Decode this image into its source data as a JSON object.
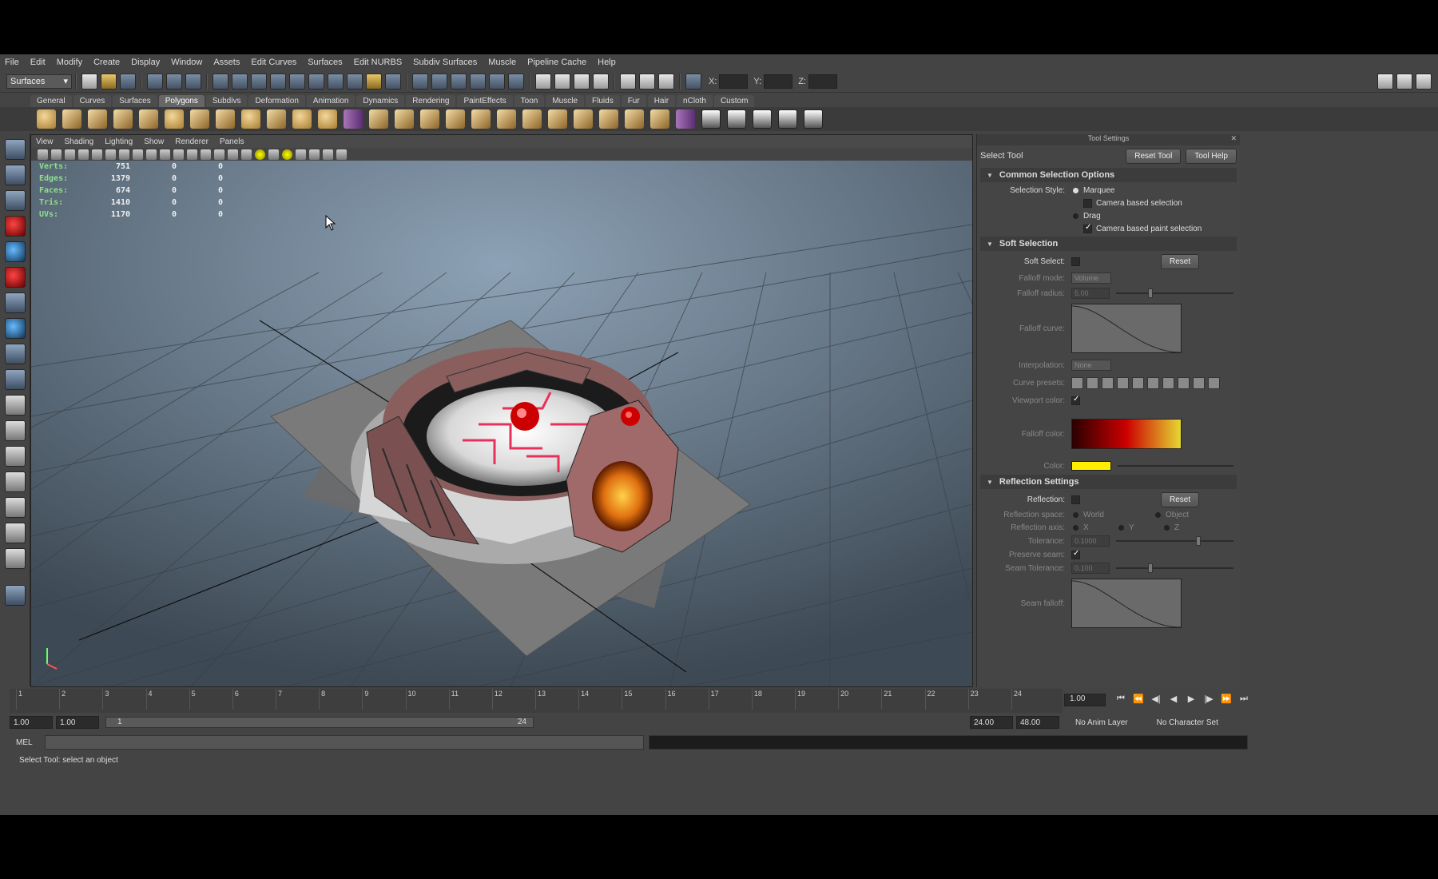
{
  "menu": [
    "File",
    "Edit",
    "Modify",
    "Create",
    "Display",
    "Window",
    "Assets",
    "Edit Curves",
    "Surfaces",
    "Edit NURBS",
    "Subdiv Surfaces",
    "Muscle",
    "Pipeline Cache",
    "Help"
  ],
  "statusline": {
    "menu_set": "Surfaces",
    "x_label": "X:",
    "y_label": "Y:",
    "z_label": "Z:"
  },
  "shelf_tabs": [
    "General",
    "Curves",
    "Surfaces",
    "Polygons",
    "Subdivs",
    "Deformation",
    "Animation",
    "Dynamics",
    "Rendering",
    "PaintEffects",
    "Toon",
    "Muscle",
    "Fluids",
    "Fur",
    "Hair",
    "nCloth",
    "Custom"
  ],
  "shelf_active": "Polygons",
  "viewport_menu": [
    "View",
    "Shading",
    "Lighting",
    "Show",
    "Renderer",
    "Panels"
  ],
  "hud": [
    {
      "label": "Verts:",
      "v": [
        "751",
        "0",
        "0"
      ]
    },
    {
      "label": "Edges:",
      "v": [
        "1379",
        "0",
        "0"
      ]
    },
    {
      "label": "Faces:",
      "v": [
        "674",
        "0",
        "0"
      ]
    },
    {
      "label": "Tris:",
      "v": [
        "1410",
        "0",
        "0"
      ]
    },
    {
      "label": "UVs:",
      "v": [
        "1170",
        "0",
        "0"
      ]
    }
  ],
  "tool_settings": {
    "panel_title": "Tool Settings",
    "tool_name": "Select Tool",
    "reset_tool": "Reset Tool",
    "tool_help": "Tool Help",
    "common": {
      "header": "Common Selection Options",
      "style_label": "Selection Style:",
      "marquee": "Marquee",
      "camera_based": "Camera based selection",
      "drag": "Drag",
      "camera_paint": "Camera based paint selection"
    },
    "soft": {
      "header": "Soft Selection",
      "soft_select": "Soft Select:",
      "reset": "Reset",
      "falloff_mode": "Falloff mode:",
      "falloff_mode_value": "Volume",
      "falloff_radius": "Falloff radius:",
      "falloff_radius_value": "5.00",
      "falloff_curve": "Falloff curve:",
      "interpolation": "Interpolation:",
      "interpolation_value": "None",
      "curve_presets": "Curve presets:",
      "viewport_color": "Viewport color:",
      "falloff_color": "Falloff color:",
      "color": "Color:"
    },
    "reflection": {
      "header": "Reflection Settings",
      "reflection": "Reflection:",
      "reset": "Reset",
      "space": "Reflection space:",
      "world": "World",
      "object": "Object",
      "axis": "Reflection axis:",
      "x": "X",
      "y": "Y",
      "z": "Z",
      "tolerance": "Tolerance:",
      "tolerance_value": "0.1000",
      "preserve_seam": "Preserve seam:",
      "seam_tolerance": "Seam Tolerance:",
      "seam_tolerance_value": "0.100",
      "seam_falloff": "Seam falloff:"
    }
  },
  "timeline": {
    "ticks": [
      "1",
      "2",
      "3",
      "4",
      "5",
      "6",
      "7",
      "8",
      "9",
      "10",
      "11",
      "12",
      "13",
      "14",
      "15",
      "16",
      "17",
      "18",
      "19",
      "20",
      "21",
      "22",
      "23",
      "24"
    ],
    "current": "1.00"
  },
  "range": {
    "start": "1.00",
    "playback_start": "1.00",
    "slider_start": "1",
    "slider_end": "24",
    "playback_end": "24.00",
    "end": "48.00",
    "anim_layer": "No Anim Layer",
    "character_set": "No Character Set"
  },
  "command": {
    "label": "MEL"
  },
  "help_line": "Select Tool: select an object",
  "colors": {
    "accent_red": "#cc0000",
    "falloff_yellow": "#e6d832",
    "color_swatch": "#ffee00"
  }
}
